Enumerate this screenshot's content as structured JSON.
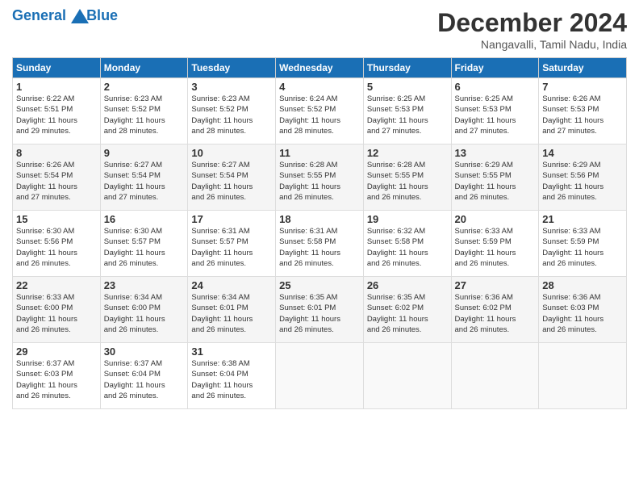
{
  "logo": {
    "line1": "General",
    "line2": "Blue"
  },
  "title": "December 2024",
  "location": "Nangavalli, Tamil Nadu, India",
  "days_of_week": [
    "Sunday",
    "Monday",
    "Tuesday",
    "Wednesday",
    "Thursday",
    "Friday",
    "Saturday"
  ],
  "weeks": [
    [
      {
        "day": "1",
        "info": "Sunrise: 6:22 AM\nSunset: 5:51 PM\nDaylight: 11 hours\nand 29 minutes."
      },
      {
        "day": "2",
        "info": "Sunrise: 6:23 AM\nSunset: 5:52 PM\nDaylight: 11 hours\nand 28 minutes."
      },
      {
        "day": "3",
        "info": "Sunrise: 6:23 AM\nSunset: 5:52 PM\nDaylight: 11 hours\nand 28 minutes."
      },
      {
        "day": "4",
        "info": "Sunrise: 6:24 AM\nSunset: 5:52 PM\nDaylight: 11 hours\nand 28 minutes."
      },
      {
        "day": "5",
        "info": "Sunrise: 6:25 AM\nSunset: 5:53 PM\nDaylight: 11 hours\nand 27 minutes."
      },
      {
        "day": "6",
        "info": "Sunrise: 6:25 AM\nSunset: 5:53 PM\nDaylight: 11 hours\nand 27 minutes."
      },
      {
        "day": "7",
        "info": "Sunrise: 6:26 AM\nSunset: 5:53 PM\nDaylight: 11 hours\nand 27 minutes."
      }
    ],
    [
      {
        "day": "8",
        "info": "Sunrise: 6:26 AM\nSunset: 5:54 PM\nDaylight: 11 hours\nand 27 minutes."
      },
      {
        "day": "9",
        "info": "Sunrise: 6:27 AM\nSunset: 5:54 PM\nDaylight: 11 hours\nand 27 minutes."
      },
      {
        "day": "10",
        "info": "Sunrise: 6:27 AM\nSunset: 5:54 PM\nDaylight: 11 hours\nand 26 minutes."
      },
      {
        "day": "11",
        "info": "Sunrise: 6:28 AM\nSunset: 5:55 PM\nDaylight: 11 hours\nand 26 minutes."
      },
      {
        "day": "12",
        "info": "Sunrise: 6:28 AM\nSunset: 5:55 PM\nDaylight: 11 hours\nand 26 minutes."
      },
      {
        "day": "13",
        "info": "Sunrise: 6:29 AM\nSunset: 5:55 PM\nDaylight: 11 hours\nand 26 minutes."
      },
      {
        "day": "14",
        "info": "Sunrise: 6:29 AM\nSunset: 5:56 PM\nDaylight: 11 hours\nand 26 minutes."
      }
    ],
    [
      {
        "day": "15",
        "info": "Sunrise: 6:30 AM\nSunset: 5:56 PM\nDaylight: 11 hours\nand 26 minutes."
      },
      {
        "day": "16",
        "info": "Sunrise: 6:30 AM\nSunset: 5:57 PM\nDaylight: 11 hours\nand 26 minutes."
      },
      {
        "day": "17",
        "info": "Sunrise: 6:31 AM\nSunset: 5:57 PM\nDaylight: 11 hours\nand 26 minutes."
      },
      {
        "day": "18",
        "info": "Sunrise: 6:31 AM\nSunset: 5:58 PM\nDaylight: 11 hours\nand 26 minutes."
      },
      {
        "day": "19",
        "info": "Sunrise: 6:32 AM\nSunset: 5:58 PM\nDaylight: 11 hours\nand 26 minutes."
      },
      {
        "day": "20",
        "info": "Sunrise: 6:33 AM\nSunset: 5:59 PM\nDaylight: 11 hours\nand 26 minutes."
      },
      {
        "day": "21",
        "info": "Sunrise: 6:33 AM\nSunset: 5:59 PM\nDaylight: 11 hours\nand 26 minutes."
      }
    ],
    [
      {
        "day": "22",
        "info": "Sunrise: 6:33 AM\nSunset: 6:00 PM\nDaylight: 11 hours\nand 26 minutes."
      },
      {
        "day": "23",
        "info": "Sunrise: 6:34 AM\nSunset: 6:00 PM\nDaylight: 11 hours\nand 26 minutes."
      },
      {
        "day": "24",
        "info": "Sunrise: 6:34 AM\nSunset: 6:01 PM\nDaylight: 11 hours\nand 26 minutes."
      },
      {
        "day": "25",
        "info": "Sunrise: 6:35 AM\nSunset: 6:01 PM\nDaylight: 11 hours\nand 26 minutes."
      },
      {
        "day": "26",
        "info": "Sunrise: 6:35 AM\nSunset: 6:02 PM\nDaylight: 11 hours\nand 26 minutes."
      },
      {
        "day": "27",
        "info": "Sunrise: 6:36 AM\nSunset: 6:02 PM\nDaylight: 11 hours\nand 26 minutes."
      },
      {
        "day": "28",
        "info": "Sunrise: 6:36 AM\nSunset: 6:03 PM\nDaylight: 11 hours\nand 26 minutes."
      }
    ],
    [
      {
        "day": "29",
        "info": "Sunrise: 6:37 AM\nSunset: 6:03 PM\nDaylight: 11 hours\nand 26 minutes."
      },
      {
        "day": "30",
        "info": "Sunrise: 6:37 AM\nSunset: 6:04 PM\nDaylight: 11 hours\nand 26 minutes."
      },
      {
        "day": "31",
        "info": "Sunrise: 6:38 AM\nSunset: 6:04 PM\nDaylight: 11 hours\nand 26 minutes."
      },
      {
        "day": "",
        "info": ""
      },
      {
        "day": "",
        "info": ""
      },
      {
        "day": "",
        "info": ""
      },
      {
        "day": "",
        "info": ""
      }
    ]
  ]
}
